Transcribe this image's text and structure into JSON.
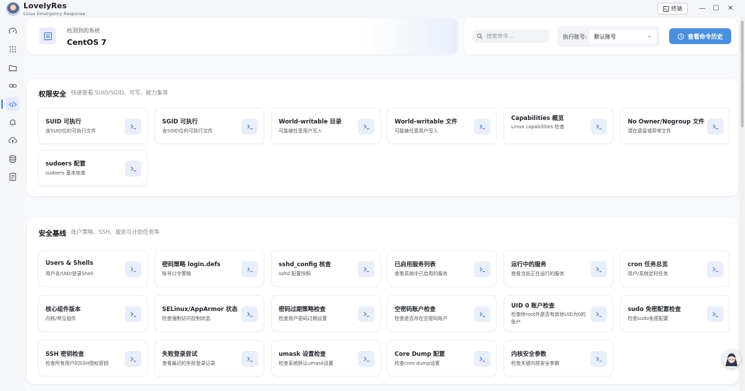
{
  "app": {
    "name": "LovelyRes",
    "subtitle": "Linux Emergency Response",
    "terminal_label": "终端"
  },
  "header": {
    "system_label": "检测到的系统",
    "system_value": "CentOS 7",
    "search_placeholder": "搜索命令...",
    "account_label": "执行账号:",
    "account_value": "默认账号",
    "history_button": "查看命令历史"
  },
  "sections": [
    {
      "title": "权限安全",
      "desc": "快速查看 SUID/SGID、可写、能力集等",
      "cards": [
        {
          "title": "SUID 可执行",
          "desc": "含SUID位的可执行文件"
        },
        {
          "title": "SGID 可执行",
          "desc": "含SGID位的可执行文件"
        },
        {
          "title": "World-writable 目录",
          "desc": "可能被任意用户写入"
        },
        {
          "title": "World-writable 文件",
          "desc": "可能被任意用户写入"
        },
        {
          "title": "Capabilities 概览",
          "desc": "Linux capabilities 检查"
        },
        {
          "title": "No Owner/Nogroup 文件",
          "desc": "潜在遗留或异常文件"
        },
        {
          "title": "sudoers 配置",
          "desc": "sudoers 基本核查"
        }
      ]
    },
    {
      "title": "安全基线",
      "desc": "账户策略、SSH、服务与计划任务等",
      "cards": [
        {
          "title": "Users & Shells",
          "desc": "用户名/UID/登录Shell"
        },
        {
          "title": "密码策略 login.defs",
          "desc": "账号口令策略"
        },
        {
          "title": "sshd_config 核查",
          "desc": "sshd 配置快照"
        },
        {
          "title": "已启用服务列表",
          "desc": "查看系统中已启用的服务"
        },
        {
          "title": "运行中的服务",
          "desc": "查看当前正在运行的服务"
        },
        {
          "title": "cron 任务总览",
          "desc": "用户/系统定时任务"
        },
        {
          "title": "核心组件版本",
          "desc": "内核/常见组件"
        },
        {
          "title": "SELinux/AppArmor 状态",
          "desc": "检查强制访问控制状态"
        },
        {
          "title": "密码过期策略检查",
          "desc": "检查用户密码过期设置"
        },
        {
          "title": "空密码账户检查",
          "desc": "检查是否存在空密码账户"
        },
        {
          "title": "UID 0 账户检查",
          "desc": "检查除root外是否有其他UID为0的账户"
        },
        {
          "title": "sudo 免密配置检查",
          "desc": "检查sudo免密配置"
        },
        {
          "title": "SSH 密钥检查",
          "desc": "检查所有用户的SSH授权密钥"
        },
        {
          "title": "失败登录尝试",
          "desc": "查看最近的失败登录记录"
        },
        {
          "title": "umask 设置检查",
          "desc": "检查系统默认umask设置"
        },
        {
          "title": "Core Dump 配置",
          "desc": "检查core dump设置"
        },
        {
          "title": "内核安全参数",
          "desc": "检查关键内核安全参数"
        }
      ]
    }
  ]
}
